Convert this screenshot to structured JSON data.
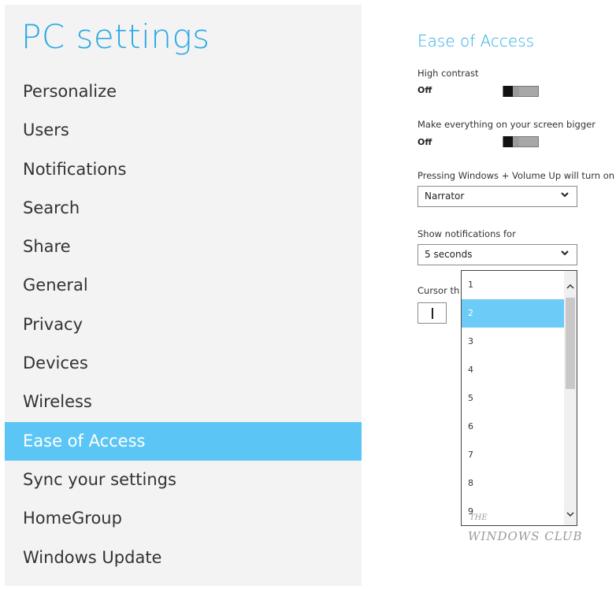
{
  "left_pane": {
    "title": "PC settings",
    "nav_items": [
      {
        "label": "Personalize"
      },
      {
        "label": "Users"
      },
      {
        "label": "Notifications"
      },
      {
        "label": "Search"
      },
      {
        "label": "Share"
      },
      {
        "label": "General"
      },
      {
        "label": "Privacy"
      },
      {
        "label": "Devices"
      },
      {
        "label": "Wireless"
      },
      {
        "label": "Ease of Access",
        "selected": true
      },
      {
        "label": "Sync your settings"
      },
      {
        "label": "HomeGroup"
      },
      {
        "label": "Windows Update"
      }
    ]
  },
  "right_pane": {
    "section_title": "Ease of Access",
    "high_contrast": {
      "label": "High contrast",
      "value": "Off"
    },
    "bigger": {
      "label": "Make everything on your screen bigger",
      "value": "Off"
    },
    "volume_up": {
      "label": "Pressing Windows + Volume Up will turn on",
      "selected": "Narrator"
    },
    "notifications": {
      "label": "Show notifications for",
      "selected": "5 seconds"
    },
    "cursor": {
      "label_visible": "Cursor th"
    }
  },
  "dropdown": {
    "options": [
      "1",
      "2",
      "3",
      "4",
      "5",
      "6",
      "7",
      "8",
      "9"
    ],
    "highlighted": "2"
  },
  "watermark": {
    "line1": "THE",
    "line2": "WINDOWS CLUB"
  },
  "colors": {
    "accent": "#2aa9e6",
    "selected_bg": "#5bc6f5",
    "highlight_bg": "#6ccbf7",
    "pane_bg": "#f3f3f3"
  }
}
